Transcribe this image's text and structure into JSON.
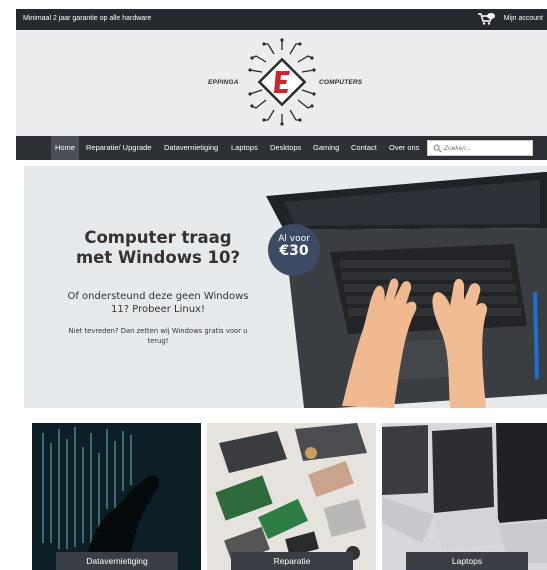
{
  "topbar": {
    "promo": "Minimaal 2 jaar garantie op alle hardware",
    "account": "Mijn account"
  },
  "logo": {
    "left": "EPPINGA",
    "right": "COMPUTERS",
    "letter": "E"
  },
  "nav": {
    "items": [
      "Home",
      "Reparatie/ Upgrade",
      "Datavernietiging",
      "Laptops",
      "Desktops",
      "Gaming",
      "Contact",
      "Over ons"
    ],
    "active": "Home"
  },
  "search": {
    "placeholder": "Zoeken..."
  },
  "hero": {
    "title": "Computer traag met Windows 10?",
    "subtitle": "Of ondersteund deze geen Windows 11? Probeer Linux!",
    "note": "Niet tevreden? Dan zetten wij Windows gratis voor u terug!",
    "badge_line1": "Al voor",
    "badge_line2": "€30"
  },
  "cards": [
    {
      "label": "Datavernietiging"
    },
    {
      "label": "Reparatie"
    },
    {
      "label": "Laptops"
    }
  ],
  "colors": {
    "topbar": "#262a30",
    "nav": "#2d3136",
    "badge": "#3c4b63",
    "logo_red": "#d2232a"
  }
}
